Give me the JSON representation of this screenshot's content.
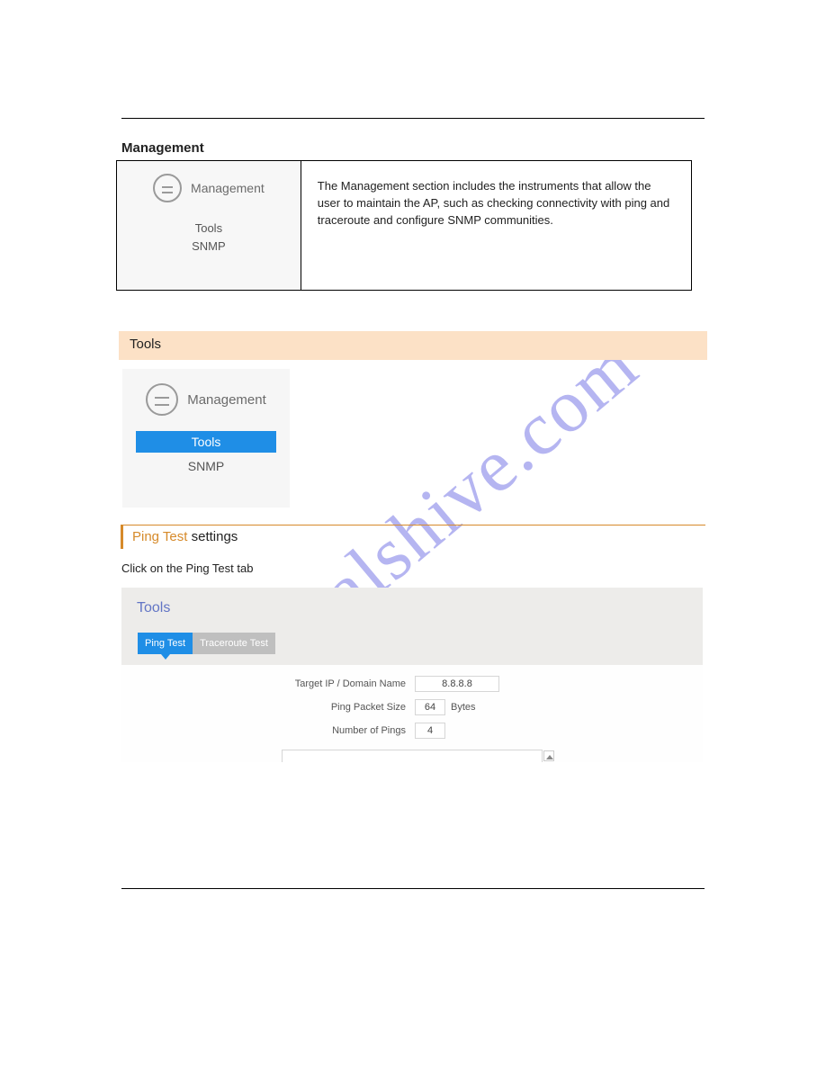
{
  "watermark": "manualshive.com",
  "section_heading": "Management",
  "mgmt_block": {
    "header": "Management",
    "items": [
      "Tools",
      "SNMP"
    ]
  },
  "table_desc": "The Management section includes the instruments that allow the user to maintain the AP, such as checking connectivity with ping and traceroute and configure SNMP communities.",
  "tools_bar": "Tools",
  "panel2": {
    "header": "Management",
    "items": [
      "Tools",
      "SNMP"
    ]
  },
  "subheader": {
    "part1": "Ping Test ",
    "part2": "settings"
  },
  "subtext": "Click on the Ping Test tab",
  "tools_panel": {
    "title": "Tools",
    "tabs": {
      "active": "Ping Test",
      "inactive": "Traceroute Test"
    },
    "rows": {
      "target": {
        "label": "Target IP / Domain Name",
        "value": "8.8.8.8"
      },
      "size": {
        "label": "Ping Packet Size",
        "value": "64",
        "unit": "Bytes"
      },
      "count": {
        "label": "Number of Pings",
        "value": "4"
      }
    }
  }
}
